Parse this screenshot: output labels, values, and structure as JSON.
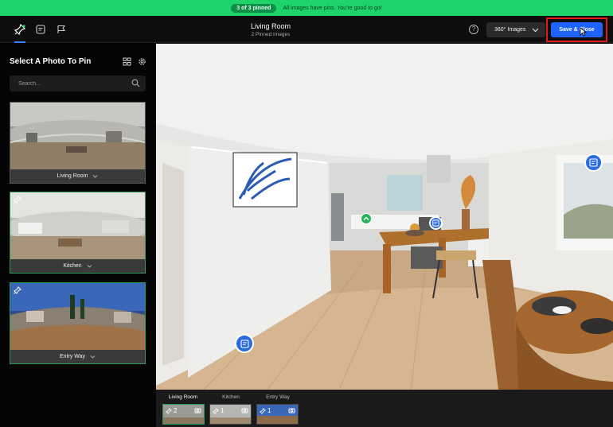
{
  "banner": {
    "pill": "3 of 3 pinned",
    "message": "All images have pins. You're good to go!"
  },
  "toolbar": {
    "tool_pin": "pin-tool",
    "tool_note": "note-tool",
    "tool_flag": "flag-tool"
  },
  "header": {
    "title": "Living Room",
    "subtitle": "2 Pinned Images"
  },
  "view_select": {
    "value": "360° Images"
  },
  "help_label": "?",
  "save_button": "Save & Close",
  "sidebar": {
    "title": "Select A Photo To Pin",
    "search_placeholder": "Search...",
    "photos": [
      {
        "label": "Living Room",
        "pinned": false
      },
      {
        "label": "Kitchen",
        "pinned": true
      },
      {
        "label": "Entry Way",
        "pinned": true
      }
    ]
  },
  "filmstrip": {
    "items": [
      {
        "label": "Living Room",
        "pins": "2",
        "active": true
      },
      {
        "label": "Kitchen",
        "pins": "1",
        "active": false
      },
      {
        "label": "Entry Way",
        "pins": "1",
        "active": false
      }
    ]
  },
  "colors": {
    "accent": "#1f63ff",
    "banner": "#1ed46a",
    "highlight": "#e01b1b",
    "pin_green": "#2e9a5a"
  }
}
